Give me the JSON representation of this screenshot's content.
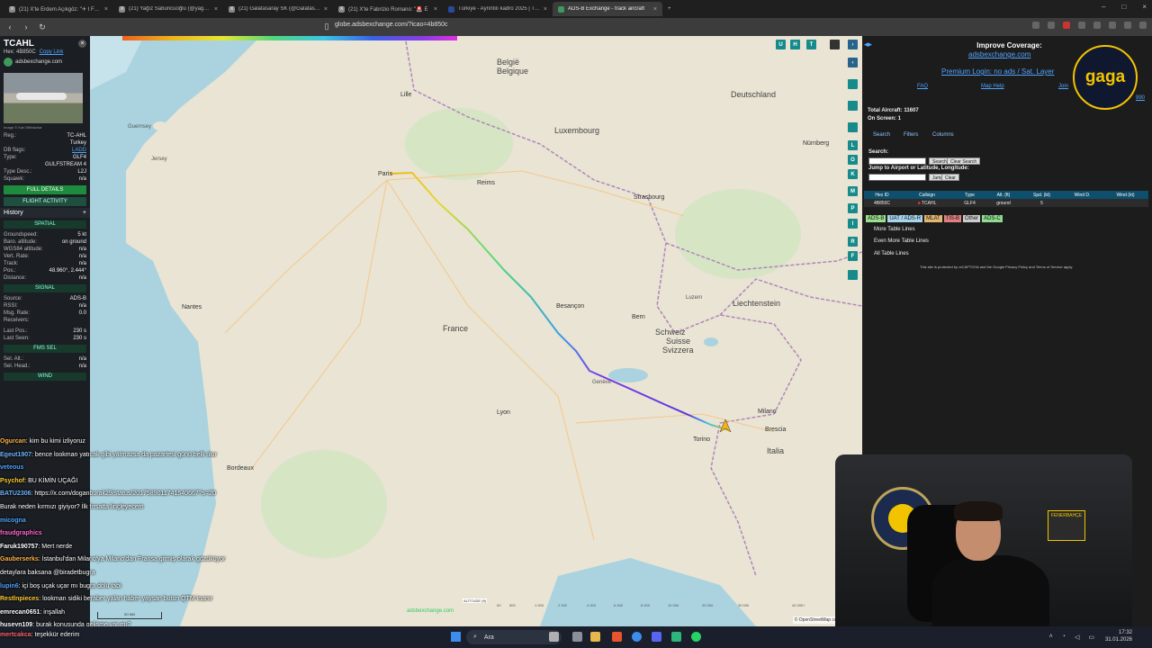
{
  "browser": {
    "tabs": [
      {
        "title": "(21) X'te Erdem Açıkgöz: \"✈ I Fener",
        "icon": "x-logo"
      },
      {
        "title": "(21) Yağız Sabuncuoğlu (@yagosab",
        "icon": "x-logo"
      },
      {
        "title": "(21) Galatasaray SK (@GalatasaraySK",
        "icon": "x-logo"
      },
      {
        "title": "(21) X'te Fabrizio Romano: \"🚨 E",
        "icon": "x-logo"
      },
      {
        "title": "Türkiye - Ayrıntılı kadro 2025 | Trans",
        "icon": "tm-logo"
      },
      {
        "title": "ADS-B Exchange - track aircraft",
        "icon": "adsb-logo",
        "active": true
      }
    ],
    "url": "globe.adsbexchange.com/?icao=4b850c"
  },
  "left_panel": {
    "callsign": "TCAHL",
    "hex_label": "Hex:",
    "hex": "4B850C",
    "copy_link": "Copy Link",
    "source_site": "adsbexchange.com",
    "photo_credit": "Image © Karl Dittbachar",
    "details": [
      {
        "k": "Reg.:",
        "v": "TC-AHL"
      },
      {
        "k": "",
        "v": "Turkey"
      },
      {
        "k": "DB flags:",
        "v": "LADD"
      },
      {
        "k": "Type:",
        "v": "GLF4"
      },
      {
        "k": "",
        "v": "GULFSTREAM 4"
      },
      {
        "k": "Type Desc.:",
        "v": "L2J"
      },
      {
        "k": "Squawk:",
        "v": "n/a"
      }
    ],
    "full_details": "FULL DETAILS",
    "flight_activity": "FLIGHT ACTIVITY",
    "history": "History",
    "spatial_title": "SPATIAL",
    "spatial": [
      {
        "k": "Groundspeed:",
        "v": "5 kt"
      },
      {
        "k": "Baro. altitude:",
        "v": "on ground"
      },
      {
        "k": "WGS84 altitude:",
        "v": "n/a"
      },
      {
        "k": "Vert. Rate:",
        "v": "n/a"
      },
      {
        "k": "Track:",
        "v": "n/a"
      },
      {
        "k": "Pos.:",
        "v": "48.960°, 2.444°"
      },
      {
        "k": "Distance:",
        "v": "n/a"
      }
    ],
    "signal_title": "SIGNAL",
    "signal": [
      {
        "k": "Source:",
        "v": "ADS-B"
      },
      {
        "k": "RSSI:",
        "v": "n/a"
      },
      {
        "k": "Msg. Rate:",
        "v": "0.0"
      },
      {
        "k": "Receivers:",
        "v": ""
      },
      {
        "k": "Last Pos.:",
        "v": "230 s"
      },
      {
        "k": "Last Seen:",
        "v": "230 s"
      }
    ],
    "fms_title": "FMS SEL",
    "fms": [
      {
        "k": "Sel. Alt.:",
        "v": "n/a"
      },
      {
        "k": "Sel. Head.:",
        "v": "n/a"
      }
    ],
    "wind_title": "WIND"
  },
  "map": {
    "countries": [
      {
        "name": "België",
        "pos": "belgie"
      },
      {
        "name": "Belgique",
        "pos": "belgique"
      },
      {
        "name": "Deutschland",
        "pos": "deutschland"
      },
      {
        "name": "Luxembourg",
        "pos": "lux"
      },
      {
        "name": "France",
        "pos": "france"
      },
      {
        "name": "Schweiz",
        "pos": "schweiz"
      },
      {
        "name": "Suisse",
        "pos": "suisse"
      },
      {
        "name": "Svizzera",
        "pos": "svizzera"
      },
      {
        "name": "Liechtenstein",
        "pos": "liechtenstein"
      },
      {
        "name": "Italia",
        "pos": "italia"
      }
    ],
    "cities": [
      {
        "name": "Paris",
        "pos": "paris"
      },
      {
        "name": "Lille",
        "pos": "lille"
      },
      {
        "name": "Reims",
        "pos": "reims"
      },
      {
        "name": "Strasbourg",
        "pos": "strasbourg"
      },
      {
        "name": "Nantes",
        "pos": "nantes"
      },
      {
        "name": "Besançon",
        "pos": "besancon"
      },
      {
        "name": "Bern",
        "pos": "bern"
      },
      {
        "name": "Lyon",
        "pos": "lyon"
      },
      {
        "name": "Torino",
        "pos": "torino"
      },
      {
        "name": "Milano",
        "pos": "milano"
      },
      {
        "name": "Brescia",
        "pos": "brescia"
      },
      {
        "name": "Bordeaux",
        "pos": "bordeaux"
      },
      {
        "name": "Nürnberg",
        "pos": "nurnberg"
      },
      {
        "name": "Guernsey",
        "pos": "guernsey"
      },
      {
        "name": "Jersey",
        "pos": "jersey"
      },
      {
        "name": "Genève",
        "pos": "geneve"
      },
      {
        "name": "Luzern",
        "pos": "luzern"
      }
    ],
    "buttons_top": [
      "U",
      "H",
      "T"
    ],
    "buttons_side": [
      "L",
      "O",
      "K",
      "M",
      "P",
      "I",
      "R",
      "F"
    ],
    "altitude_label": "ALTITUDE (ft)",
    "altitude_ticks": [
      "00",
      "500",
      "1 000",
      "2 000",
      "4 000",
      "6 000",
      "8 000",
      "10 000",
      "20 000",
      "30 000",
      "40 000+"
    ],
    "scale_label": "50 NM",
    "watermark": "adsbexchange.com",
    "attribution": "© OpenStreetMap contributors."
  },
  "sidebar": {
    "improve": "Improve Coverage:",
    "improve_link": "adsbexchange.com",
    "premium": "Premium Login: no ads / Sat. Layer",
    "links": [
      "FAQ",
      "Map Help",
      "Join"
    ],
    "aside_link": "990",
    "total_aircraft": "Total Aircraft: 11607",
    "on_screen": "On Screen: 1",
    "tabs": [
      "Search",
      "Filters",
      "Columns"
    ],
    "search_label": "Search:",
    "search_btn": "Search",
    "clear_search": "Clear Search",
    "jump_label": "Jump to Airport or Latitude, Longitude:",
    "jump_btn": "Jump",
    "clear_btn": "Clear",
    "table_headers": [
      "Hex ID",
      "Callsign",
      "Type",
      "Alt. (ft)",
      "Spd. (kt)",
      "Wind D.",
      "Wind (kt)"
    ],
    "table_rows": [
      [
        "4B850C",
        "TCAHL",
        "GLF4",
        "ground",
        "5",
        "",
        ""
      ]
    ],
    "legend_tags": [
      {
        "label": "ADS-B",
        "color": "#9ae08d"
      },
      {
        "label": "UAT / ADS-R",
        "color": "#a6d6ee"
      },
      {
        "label": "MLAT",
        "color": "#e3b86e"
      },
      {
        "label": "TIS-B",
        "color": "#e08080"
      },
      {
        "label": "Other",
        "color": "#cccccc"
      },
      {
        "label": "ADS-C",
        "color": "#8edc8e"
      }
    ],
    "more_lines": [
      "More Table Lines",
      "Even More Table Lines",
      "All Table Lines"
    ],
    "recaptcha": "This site is protected by reCAPTCHA and the Google Privacy Policy and Terms of Service apply.",
    "logo_text": "gaga"
  },
  "chat": [
    {
      "user": "Ogurcan",
      "color": "#ffb347",
      "text": ": kim bu kimi izliyoruz"
    },
    {
      "user": "Egeut1907",
      "color": "#6fb3ff",
      "text": ": bence lookman yatıcak gibi yatmazsa da pazartesi günü belli olur"
    },
    {
      "user": "veteous",
      "color": "#4fa3ff",
      "text": ""
    },
    {
      "user": "Psychof",
      "color": "#ffcc33",
      "text": ": BU KİMİN UÇAĞI"
    },
    {
      "user": "BATU2306",
      "color": "#6fb3ff",
      "text": ": https://x.com/doganburak29/status/2017589011741540667?s=20"
    },
    {
      "user": "",
      "color": "#ffffff",
      "text": "Burak neden kırmızı giyiyor? İlk fırsatta linçleyecem"
    },
    {
      "user": "micogna",
      "color": "#4fa3ff",
      "text": ""
    },
    {
      "user": "fraudgraphics",
      "color": "#ff66cc",
      "text": ""
    },
    {
      "user": "Faruk190757",
      "color": "#ffffff",
      "text": ": Mert nerde"
    },
    {
      "user": "Gauberserks",
      "color": "#ffb347",
      "text": ": İstanbul'dan Milano'ya Milano'dan Fransa gitmiş olarak gözüküyor"
    },
    {
      "user": "",
      "color": "#ffffff",
      "text": "detaylara baksana @biradetbugra"
    },
    {
      "user": "lupin6",
      "color": "#4fa3ff",
      "text": ": içi boş uçak uçar mı bugra dolu tabi"
    },
    {
      "user": "Restlnpieces",
      "color": "#ffcc33",
      "text": ": lookman sidiki beraber yalan haber yaysan butun QTM inanır"
    },
    {
      "user": "emrecan0651",
      "color": "#ffffff",
      "text": ": inşallah"
    },
    {
      "user": "huseyn109",
      "color": "#ffffff",
      "text": ": burak konusunda gelişme var mı?"
    },
    {
      "user": "mertcakca",
      "color": "#ff6666",
      "text": ": teşekkür ederim"
    }
  ],
  "webcam": {
    "book_text": "FENERBAHÇE"
  },
  "taskbar": {
    "search": "Ara",
    "time": "17:32",
    "date": "31.01.2026"
  }
}
